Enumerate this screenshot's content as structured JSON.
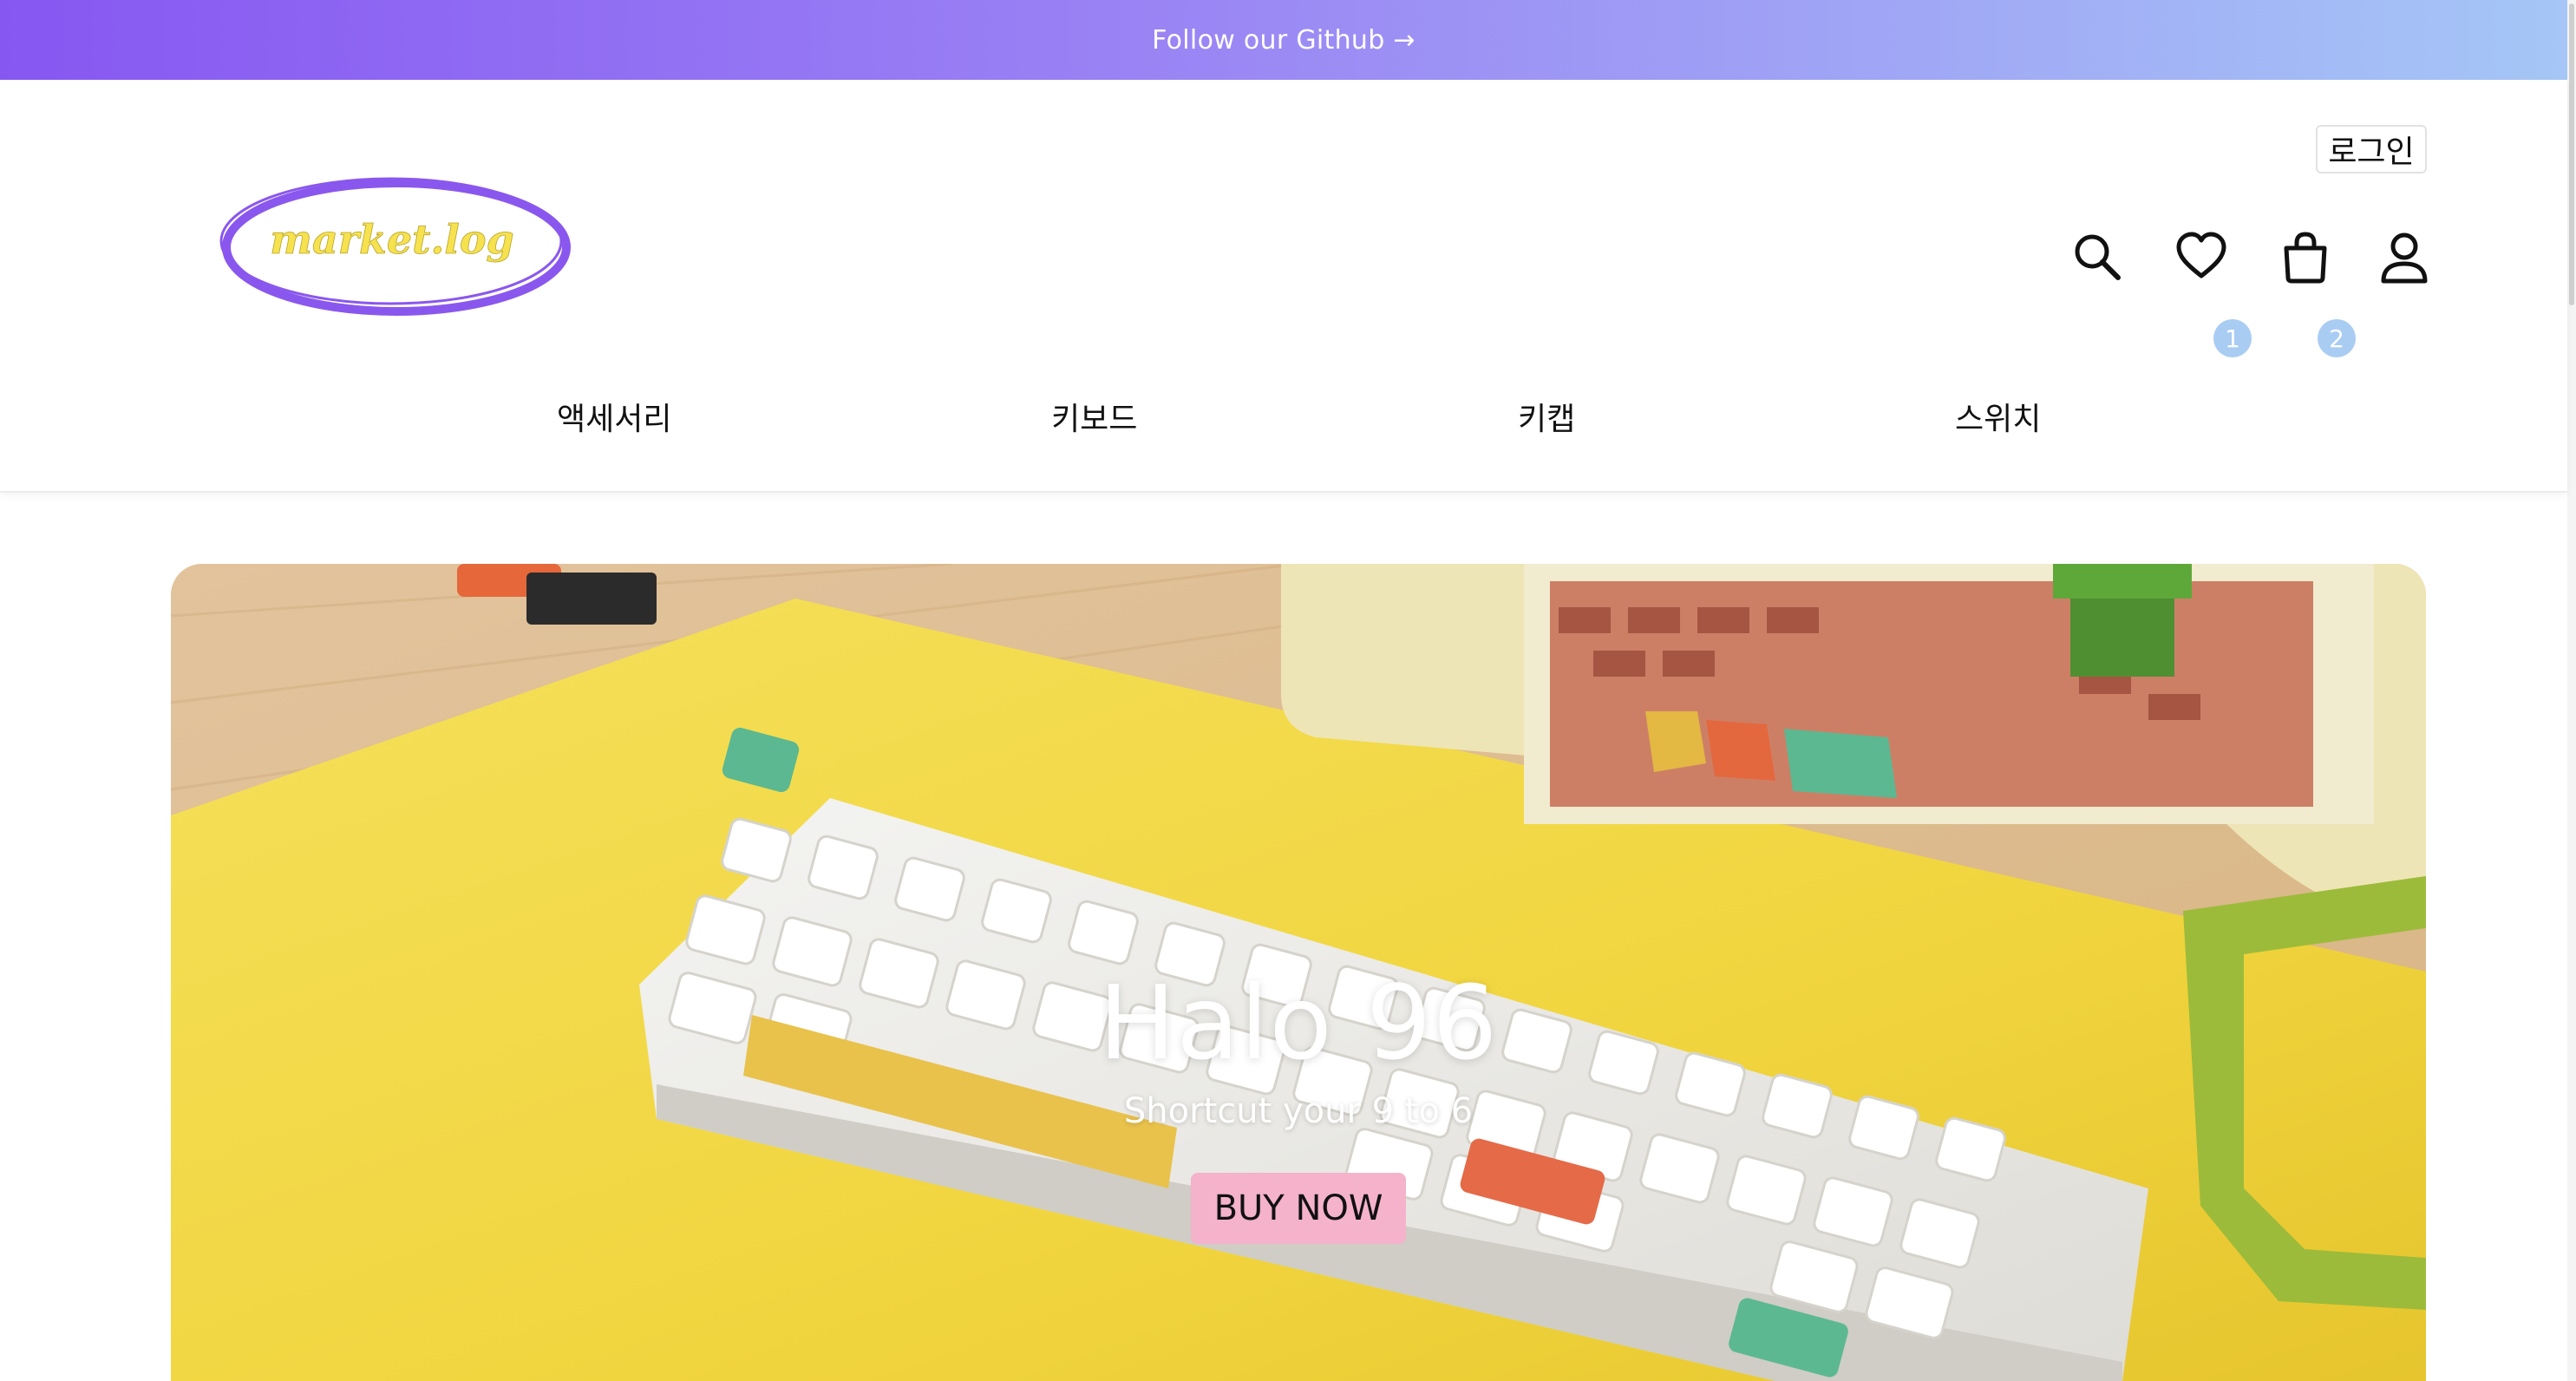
{
  "promo": {
    "text": "Follow our Github →"
  },
  "header": {
    "logo_text": "market.log",
    "login_label": "로그인",
    "wishlist_count": "1",
    "cart_count": "2"
  },
  "nav": {
    "items": [
      "액세서리",
      "키보드",
      "키캡",
      "스위치"
    ]
  },
  "hero": {
    "title": "Halo 96",
    "subtitle": "Shortcut your 9 to 6",
    "button_label": "BUY NOW"
  },
  "colors": {
    "banner_start": "#8757f2",
    "banner_end": "#a5c6f6",
    "logo_ring": "#8a57ee",
    "logo_text": "#f6e24f",
    "badge": "#a9ccf3",
    "buy_button": "#f4b2cb"
  },
  "icons": [
    "search-icon",
    "heart-icon",
    "shopping-bag-icon",
    "user-icon"
  ]
}
